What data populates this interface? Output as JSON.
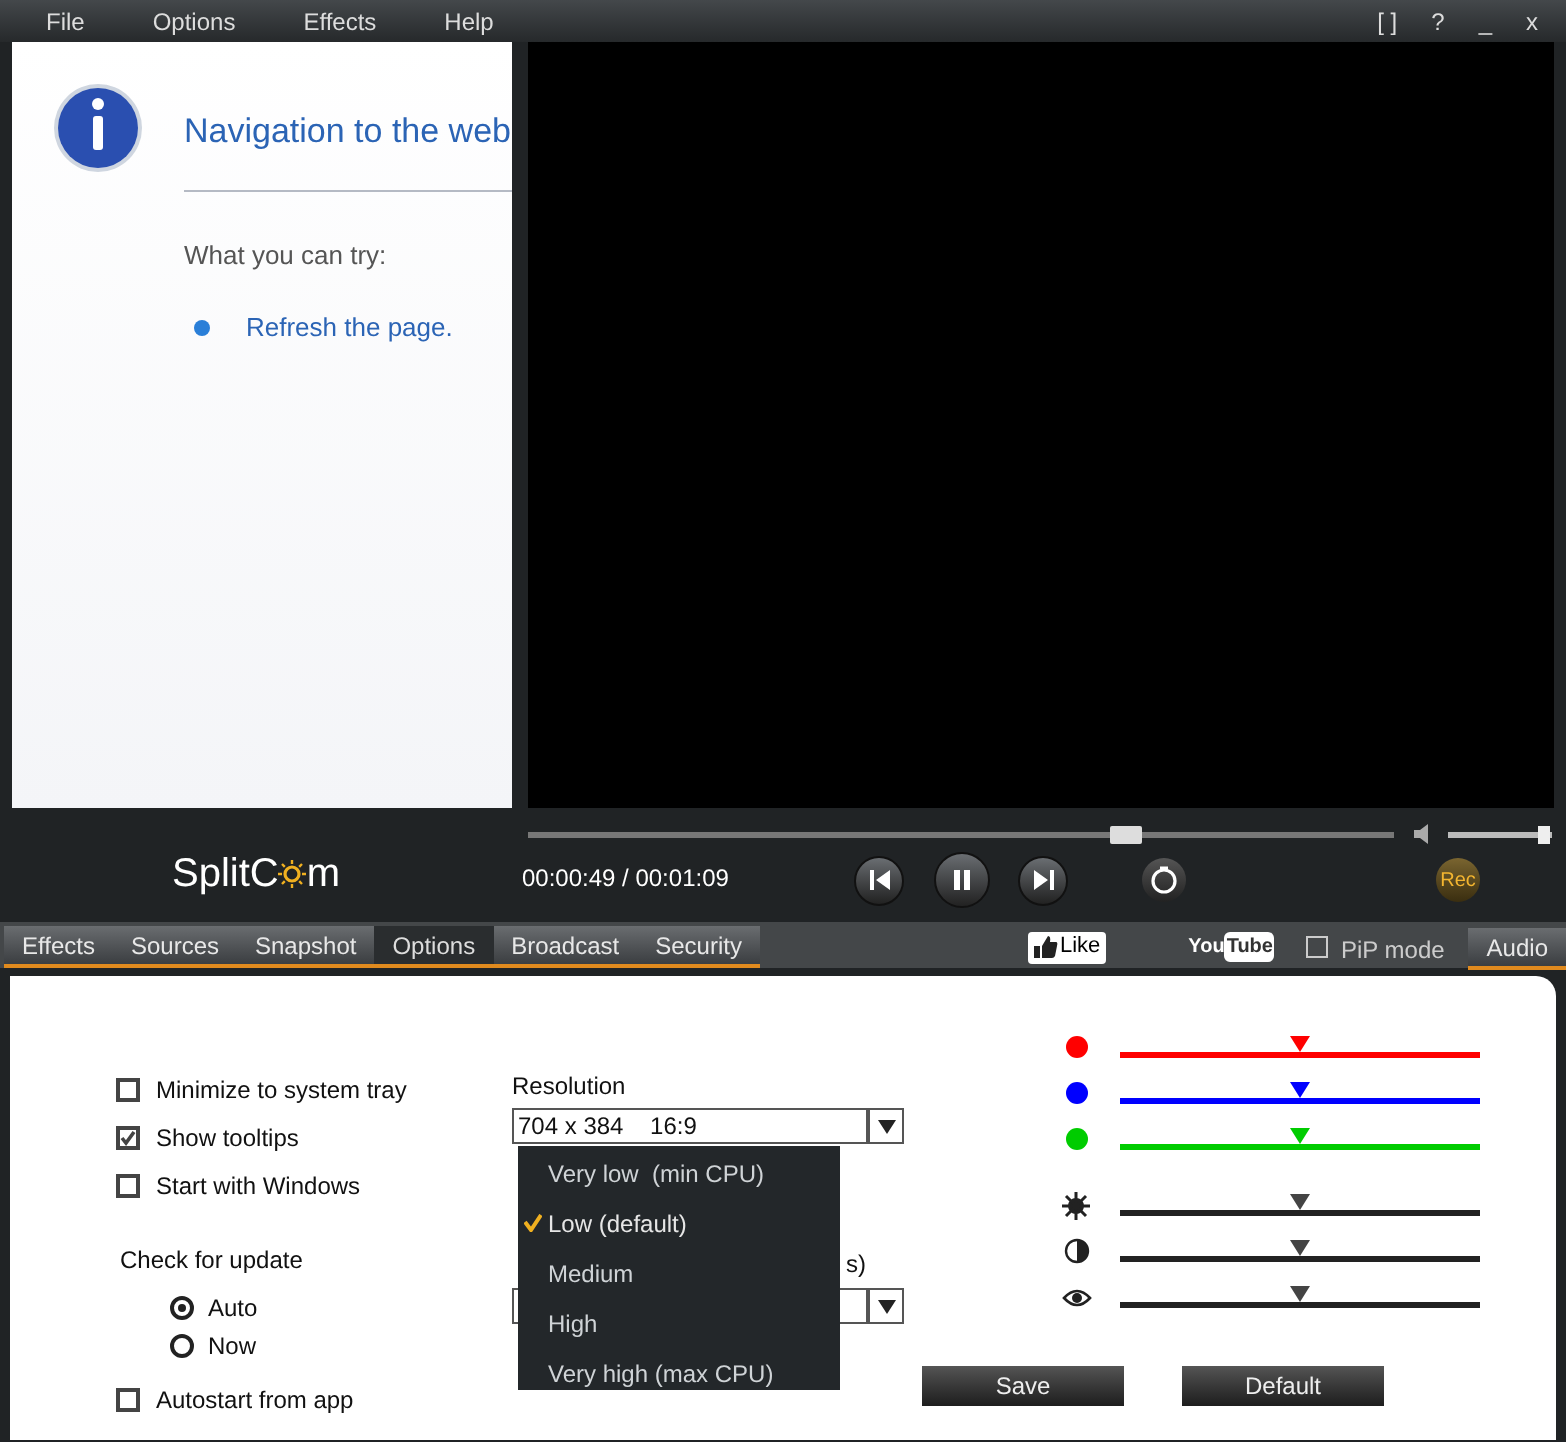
{
  "menu": [
    "File",
    "Options",
    "Effects",
    "Help"
  ],
  "window_controls": [
    "[ ]",
    "?",
    "_",
    "x"
  ],
  "browser_panel": {
    "title": "Navigation to the web",
    "subtitle": "What you can try:",
    "links": [
      "Refresh the page."
    ]
  },
  "player": {
    "seek": {
      "level": 0.69
    },
    "volume": {
      "level": 0.92
    },
    "time": "00:00:49 / 00:01:09",
    "rec": "Rec"
  },
  "logo": {
    "parts": [
      "Split",
      "C",
      "m"
    ]
  },
  "tabs": [
    {
      "label": "Effects",
      "selected": false
    },
    {
      "label": "Sources",
      "selected": false
    },
    {
      "label": "Snapshot",
      "selected": false
    },
    {
      "label": "Options",
      "selected": true
    },
    {
      "label": "Broadcast",
      "selected": false
    },
    {
      "label": "Security",
      "selected": false
    }
  ],
  "like": "Like",
  "youtube": {
    "left": "You",
    "right": "Tube"
  },
  "pip": {
    "label": "PiP mode",
    "checked": false
  },
  "audio_tab": {
    "label": "Audio",
    "selected": false
  },
  "options": [
    {
      "label": "Minimize to system tray",
      "checked": false
    },
    {
      "label": "Show tooltips",
      "checked": true
    },
    {
      "label": "Start with Windows",
      "checked": false
    }
  ],
  "update": {
    "label": "Check for update",
    "choices": [
      {
        "label": "Auto",
        "selected": true
      },
      {
        "label": "Now",
        "selected": false
      }
    ]
  },
  "autostart": {
    "label": "Autostart from app",
    "checked": false
  },
  "resolution": {
    "label": "Resolution",
    "value": "704 x 384    16:9"
  },
  "hidden_label_tail": "s)",
  "quality_menu": [
    {
      "label": "Very low  (min CPU)",
      "selected": false
    },
    {
      "label": "Low (default)",
      "selected": true
    },
    {
      "label": "Medium",
      "selected": false
    },
    {
      "label": "High",
      "selected": false
    },
    {
      "label": "Very high (max CPU)",
      "selected": false
    }
  ],
  "adjust": [
    {
      "kind": "color",
      "color": "#ff0000",
      "level": 0.5
    },
    {
      "kind": "color",
      "color": "#0000ff",
      "level": 0.5
    },
    {
      "kind": "color",
      "color": "#00cc00",
      "level": 0.5
    },
    {
      "kind": "brightness",
      "level": 0.5
    },
    {
      "kind": "contrast",
      "level": 0.5
    },
    {
      "kind": "eye",
      "level": 0.5
    }
  ],
  "buttons": [
    "Save",
    "Default"
  ]
}
